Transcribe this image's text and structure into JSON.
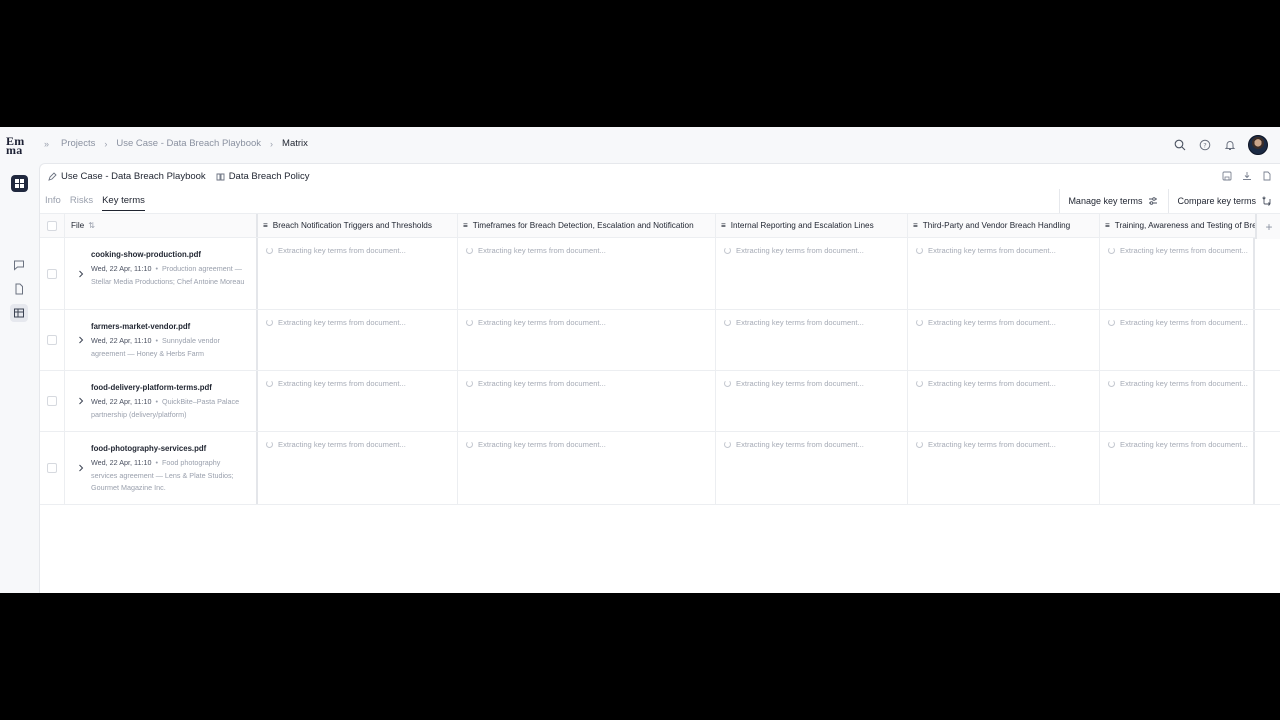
{
  "app": {
    "logo_line1": "Em",
    "logo_line2": "ma"
  },
  "breadcrumbs": [
    "Projects",
    "Use Case - Data Breach Playbook",
    "Matrix"
  ],
  "doc_tabs": [
    {
      "label": "Use Case - Data Breach Playbook",
      "icon": "pencil-icon"
    },
    {
      "label": "Data Breach Policy",
      "icon": "book-icon"
    }
  ],
  "sub_tabs": [
    {
      "label": "Info",
      "active": false
    },
    {
      "label": "Risks",
      "active": false
    },
    {
      "label": "Key terms",
      "active": true
    }
  ],
  "key_term_actions": {
    "manage": "Manage key terms",
    "compare": "Compare key terms"
  },
  "table": {
    "file_header": "File",
    "columns": [
      "Breach Notification Triggers and Thresholds",
      "Timeframes for Breach Detection, Escalation and Notification",
      "Internal Reporting and Escalation Lines",
      "Third-Party and Vendor Breach Handling",
      "Training, Awareness and Testing of Breach"
    ],
    "extracting_text": "Extracting key terms from document...",
    "rows": [
      {
        "name": "cooking-show-production.pdf",
        "date": "Wed, 22 Apr, 11:10",
        "desc": "Production agreement — Stellar Media Productions; Chef Antoine Moreau"
      },
      {
        "name": "farmers-market-vendor.pdf",
        "date": "Wed, 22 Apr, 11:10",
        "desc": "Sunnydale vendor agreement — Honey & Herbs Farm"
      },
      {
        "name": "food-delivery-platform-terms.pdf",
        "date": "Wed, 22 Apr, 11:10",
        "desc": "QuickBite–Pasta Palace partnership (delivery/platform)"
      },
      {
        "name": "food-photography-services.pdf",
        "date": "Wed, 22 Apr, 11:10",
        "desc": "Food photography services agreement — Lens & Plate Studios; Gourmet Magazine Inc."
      }
    ]
  }
}
